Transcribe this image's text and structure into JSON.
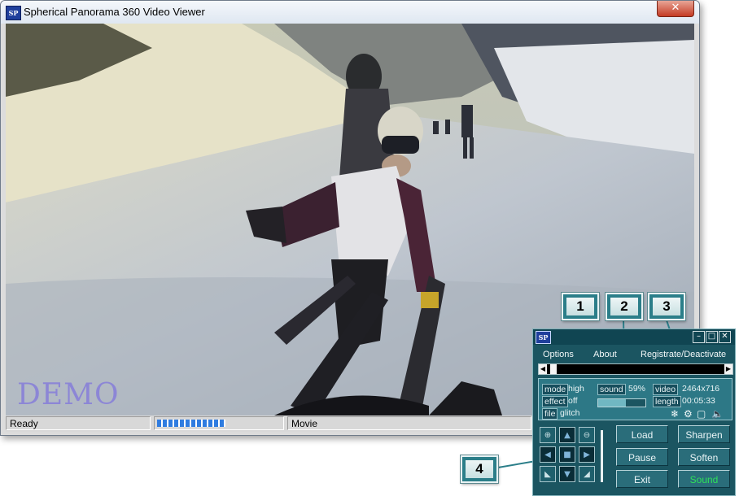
{
  "window": {
    "title": "Spherical Panorama 360 Video Viewer",
    "icon": "sp-app-icon",
    "close_label": "✕"
  },
  "video": {
    "watermark": "DEMO"
  },
  "statusbar": {
    "status": "Ready",
    "progress": 0.55,
    "mode": "Movie"
  },
  "callouts": [
    "1",
    "2",
    "3",
    "4"
  ],
  "panel": {
    "icon": "sp-app-icon",
    "menu": {
      "options": "Options",
      "about": "About",
      "register": "Registrate/Deactivate"
    },
    "info": {
      "mode_label": "mode",
      "mode_value": "high",
      "sound_label": "sound",
      "sound_value": "59%",
      "sound_level": 0.59,
      "video_label": "video",
      "video_value": "2464x716",
      "effect_label": "effect",
      "effect_value": "off",
      "length_label": "length",
      "length_value": "00:05:33",
      "file_label": "file",
      "file_value": "glitch"
    },
    "buttons": {
      "load": "Load",
      "sharpen": "Sharpen",
      "pause": "Pause",
      "soften": "Soften",
      "exit": "Exit",
      "sound": "Sound"
    },
    "colors": {
      "panel_bg": "#1b5561",
      "sound_button_text": "#2ee05a"
    }
  }
}
